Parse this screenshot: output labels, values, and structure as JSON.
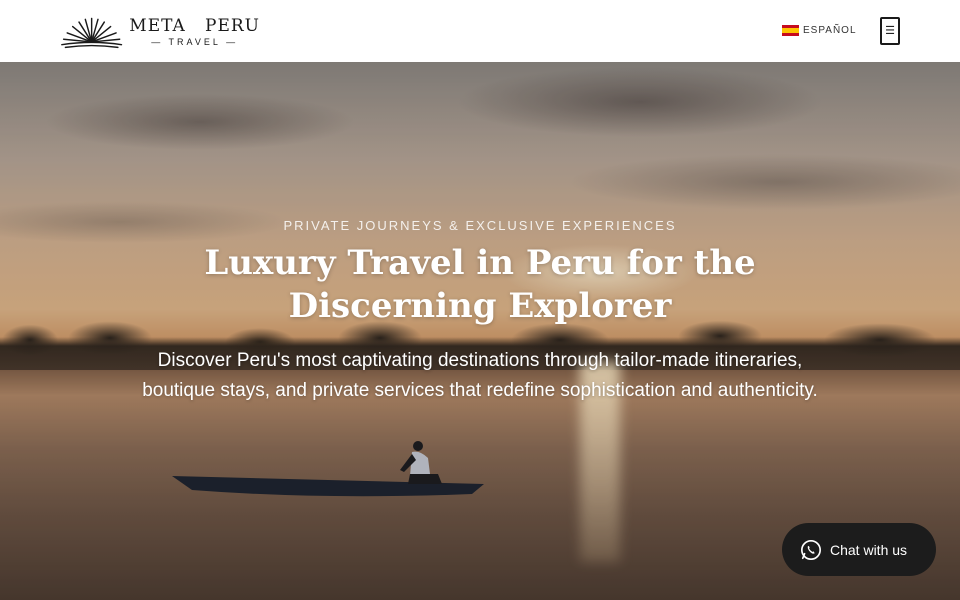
{
  "header": {
    "logo_name": "META   PERU",
    "logo_sub": "— TRAVEL —",
    "language_label": "ESPAÑOL",
    "menu_icon": "☰"
  },
  "hero": {
    "kicker": "PRIVATE JOURNEYS & EXCLUSIVE EXPERIENCES",
    "headline": "Luxury Travel in Peru for the Discerning Explorer",
    "subtext": "Discover Peru's most captivating destinations through tailor-made itineraries, boutique stays, and private services that redefine sophistication and authenticity."
  },
  "chat": {
    "label": "Chat with us",
    "icon": "whatsapp-icon"
  },
  "colors": {
    "header_bg": "#ffffff",
    "chat_bg": "#1c1c1c",
    "text_light": "#ffffff"
  }
}
